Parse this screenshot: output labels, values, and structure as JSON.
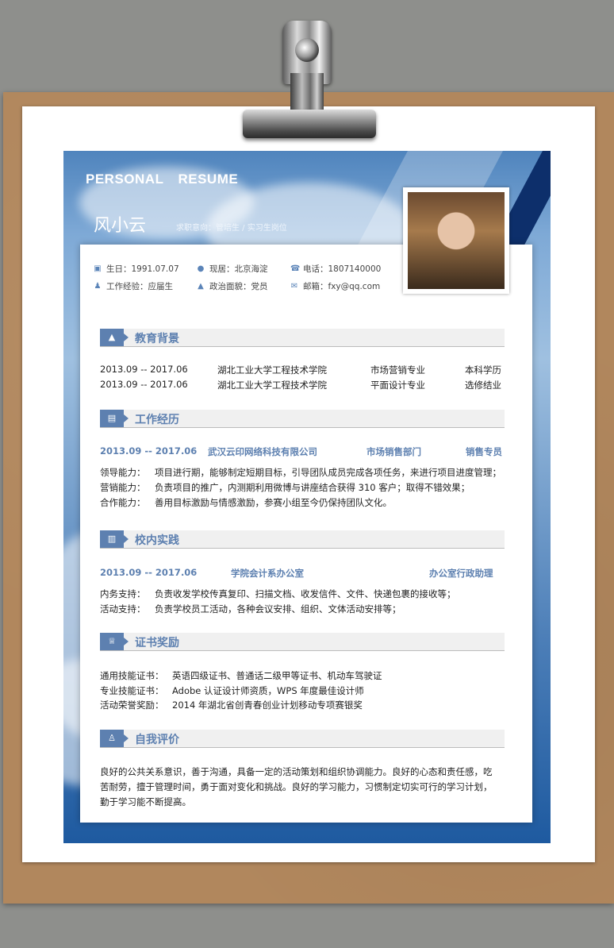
{
  "header": {
    "title_left": "PERSONAL",
    "title_right": "RESUME",
    "name": "风小云",
    "intent": "求职意向：管培生 / 实习生岗位"
  },
  "info": {
    "birthday": "生日：1991.07.07",
    "location": "现居：北京海淀",
    "phone": "电话：1807140000",
    "experience": "工作经验：应届生",
    "politics": "政治面貌：党员",
    "email": "邮箱：fxy@qq.com"
  },
  "education": {
    "title": "教育背景",
    "rows": [
      {
        "date": "2013.09 -- 2017.06",
        "school": "湖北工业大学工程技术学院",
        "major": "市场营销专业",
        "degree": "本科学历"
      },
      {
        "date": "2013.09 -- 2017.06",
        "school": "湖北工业大学工程技术学院",
        "major": "平面设计专业",
        "degree": "选修结业"
      }
    ]
  },
  "work": {
    "title": "工作经历",
    "date": "2013.09 -- 2017.06",
    "company": "武汉云印网络科技有限公司",
    "dept": "市场销售部门",
    "role": "销售专员",
    "lines": [
      {
        "label": "领导能力：",
        "text": "项目进行期，能够制定短期目标，引导团队成员完成各项任务，来进行项目进度管理；"
      },
      {
        "label": "营销能力：",
        "text": "负责项目的推广，内测期利用微博与讲座结合获得 310 客户；取得不错效果；"
      },
      {
        "label": "合作能力：",
        "text": "善用目标激励与情感激励，参赛小组至今仍保持团队文化。"
      }
    ]
  },
  "campus": {
    "title": "校内实践",
    "date": "2013.09 -- 2017.06",
    "org": "学院会计系办公室",
    "role": "办公室行政助理",
    "lines": [
      {
        "label": "内务支持：",
        "text": "负责收发学校传真复印、扫描文档、收发信件、文件、快递包裹的接收等；"
      },
      {
        "label": "活动支持：",
        "text": "负责学校员工活动，各种会议安排、组织、文体活动安排等；"
      }
    ]
  },
  "awards": {
    "title": "证书奖励",
    "lines": [
      {
        "label": "通用技能证书：",
        "text": "英语四级证书、普通话二级甲等证书、机动车驾驶证"
      },
      {
        "label": "专业技能证书：",
        "text": "Adobe 认证设计师资质，WPS 年度最佳设计师"
      },
      {
        "label": "活动荣誉奖励：",
        "text": "2014 年湖北省创青春创业计划移动专项赛银奖"
      }
    ]
  },
  "self": {
    "title": "自我评价",
    "lines": [
      "良好的公共关系意识，善于沟通，具备一定的活动策划和组织协调能力。良好的心态和责任感，吃",
      "苦耐劳，擅于管理时间，勇于面对变化和挑战。良好的学习能力，习惯制定切实可行的学习计划，",
      "勤于学习能不断提高。"
    ]
  },
  "icons": [
    "calendar-icon",
    "location-icon",
    "phone-icon",
    "person-icon",
    "flag-icon",
    "email-icon",
    "graduation-cap-icon",
    "book-icon",
    "chart-icon",
    "trophy-icon",
    "user-icon"
  ]
}
